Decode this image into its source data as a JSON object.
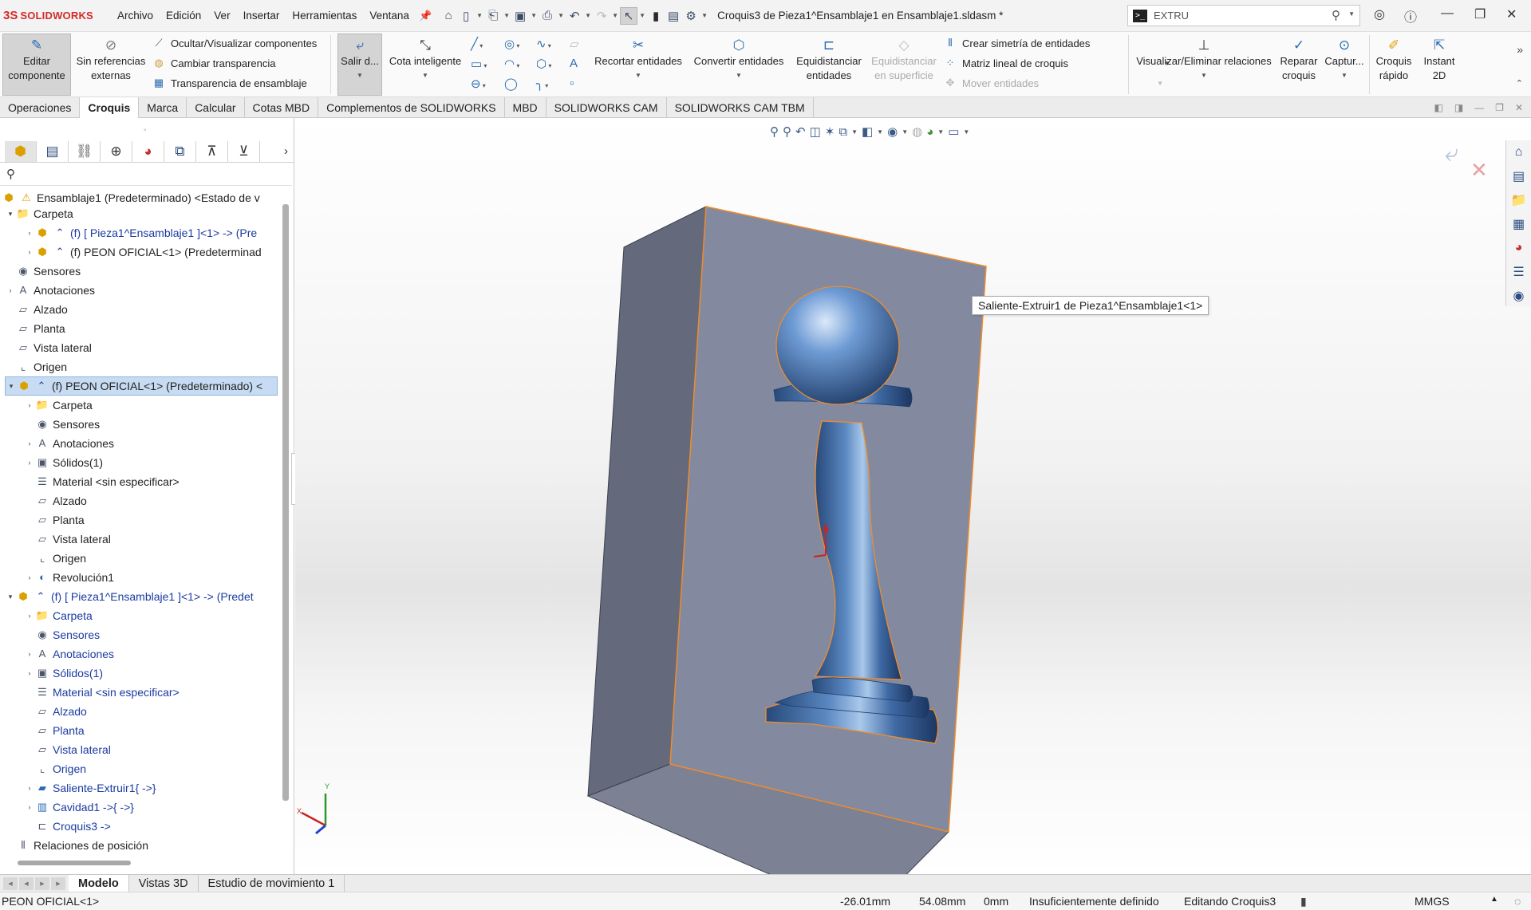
{
  "app": {
    "logo_mark": "3S",
    "logo_name": "SOLIDWORKS",
    "menu": [
      "Archivo",
      "Edición",
      "Ver",
      "Insertar",
      "Herramientas",
      "Ventana"
    ],
    "document_title": "Croquis3 de Pieza1^Ensamblaje1 en Ensamblaje1.sldasm *",
    "search": {
      "prompt": ">_",
      "value": "EXTRU"
    }
  },
  "ribbon": {
    "editar_componente": "Editar componente",
    "sin_referencias": "Sin referencias externas",
    "ocultar": "Ocultar/Visualizar componentes",
    "cambiar_transparencia": "Cambiar transparencia",
    "transparencia_ensamblaje": "Transparencia de ensamblaje",
    "salir": "Salir d...",
    "cota": "Cota inteligente",
    "recortar": "Recortar entidades",
    "convertir": "Convertir entidades",
    "equidistanciar": "Equidistanciar entidades",
    "equidistanciar_sup": "Equidistanciar en superficie",
    "simetria": "Crear simetría de entidades",
    "matriz": "Matriz lineal de croquis",
    "mover": "Mover entidades",
    "relaciones": "Visualizar/Eliminar relaciones",
    "reparar": "Reparar croquis",
    "captura": "Captur...",
    "croquis_rapido": "Croquis rápido",
    "instant2d": "Instant 2D"
  },
  "tabs": [
    "Operaciones",
    "Croquis",
    "Marca",
    "Calcular",
    "Cotas MBD",
    "Complementos de SOLIDWORKS",
    "MBD",
    "SOLIDWORKS CAM",
    "SOLIDWORKS CAM TBM"
  ],
  "active_tab": "Croquis",
  "tree": {
    "root": "Ensamblaje1 (Predeterminado) <Estado de v",
    "items": [
      "Carpeta",
      "(f) [ Pieza1^Ensamblaje1 ]<1> -> (Pre",
      "(f) PEON OFICIAL<1> (Predeterminad",
      "Sensores",
      "Anotaciones",
      "Alzado",
      "Planta",
      "Vista lateral",
      "Origen",
      "(f) PEON OFICIAL<1> (Predeterminado) <",
      "Carpeta",
      "Sensores",
      "Anotaciones",
      "Sólidos(1)",
      "Material <sin especificar>",
      "Alzado",
      "Planta",
      "Vista lateral",
      "Origen",
      "Revolución1",
      "(f) [ Pieza1^Ensamblaje1 ]<1> -> (Predet",
      "Carpeta",
      "Sensores",
      "Anotaciones",
      "Sólidos(1)",
      "Material <sin especificar>",
      "Alzado",
      "Planta",
      "Vista lateral",
      "Origen",
      "Saliente-Extruir1{ ->}",
      "Cavidad1 ->{ ->}",
      "Croquis3 ->",
      "Relaciones de posición"
    ]
  },
  "viewport": {
    "tooltip": "Saliente-Extruir1 de Pieza1^Ensamblaje1<1>",
    "triad_y": "Y",
    "triad_x": "X"
  },
  "bottom_tabs": [
    "Modelo",
    "Vistas 3D",
    "Estudio de movimiento 1"
  ],
  "status": {
    "component": "PEON OFICIAL<1>",
    "x": "-26.01mm",
    "y": "54.08mm",
    "z": "0mm",
    "state": "Insuficientemente definido",
    "editing": "Editando Croquis3",
    "units": "MMGS"
  },
  "colors": {
    "accent": "#2a6bb0",
    "selection": "#c7dcf2",
    "edge_highlight": "#f08c2a"
  }
}
